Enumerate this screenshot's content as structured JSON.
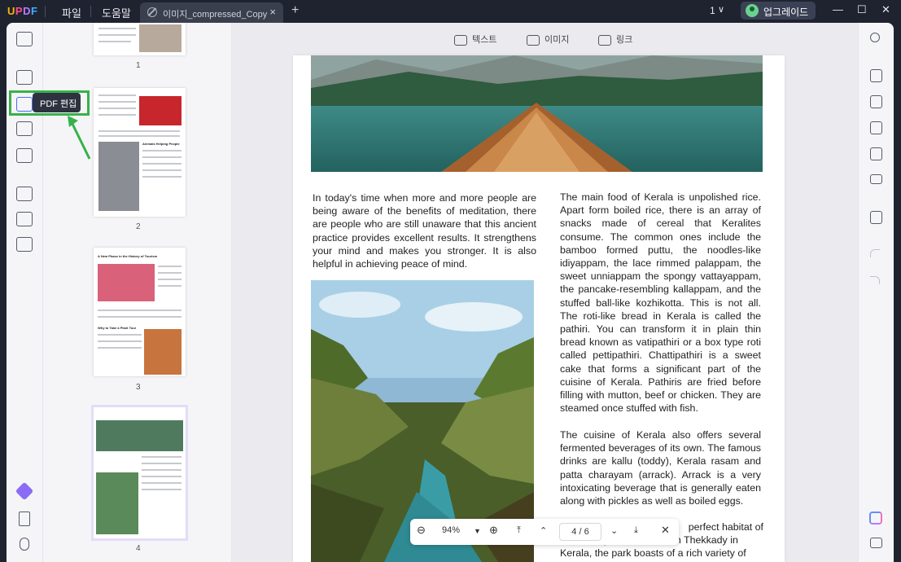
{
  "app": {
    "name_parts": [
      "U",
      "P",
      "D",
      "F"
    ]
  },
  "menu": {
    "file": "파일",
    "help": "도움말"
  },
  "tab": {
    "title": "이미지_compressed_Copy",
    "close": "×",
    "add": "+"
  },
  "titlebar": {
    "page_indicator": "1",
    "chevron": "∨",
    "upgrade_label": "업그레이드",
    "minimize": "—",
    "maximize": "☐",
    "close": "✕"
  },
  "tooltip": {
    "label": "PDF 편집"
  },
  "toolbar": {
    "text_label": "텍스트",
    "image_label": "이미지",
    "link_label": "링크"
  },
  "thumbnails": [
    {
      "number": "1"
    },
    {
      "number": "2",
      "heading": "Animals Helping People"
    },
    {
      "number": "3",
      "heading": "A New Phase in the History of Tourism",
      "subheading": "Why to Take a Plant Tour"
    },
    {
      "number": "4"
    }
  ],
  "document": {
    "left_paragraph": "In today's time when more and more people are being aware of the benefits of meditation, there are people who are still unaware that this ancient practice provides excellent results. It strengthens your mind and makes you stronger. It is also helpful in achieving peace of mind.",
    "right_paragraph_1": "The main food of Kerala is unpolished rice. Apart form boiled rice, there is an array of snacks made of cereal that Keralites consume. The common ones include the bamboo formed puttu, the noodles-like idiyappam, the lace rimmed palappam, the sweet unniappam the spongy vattayappam, the pancake-resembling kallappam, and the stuffed ball-like kozhikotta. This is not all. The roti-like bread in Kerala is called the pathiri. You can transform it in plain thin bread known as vatipathiri or a box type roti called pettipathiri. Chattipathiri is a sweet cake that forms a significant part of the cuisine of Kerala. Pathiris are fried before filling with mutton, beef or chicken. They are steamed once stuffed with fish.",
    "right_paragraph_2": "The cuisine of Kerala also offers several fermented beverages of its own. The famous drinks are kallu (toddy), Kerala rasam and patta charayam (arrack). Arrack is a very intoxicating beverage that is generally eaten along with pickles as well as boiled eggs.",
    "right_paragraph_3_visible": "perfect habitat of",
    "right_line_2": "Indian elephant. Located in Thekkady in",
    "right_line_3": "Kerala, the park boasts of a rich variety of"
  },
  "zoombar": {
    "zoom": "94%",
    "page": "4",
    "slash": "/",
    "total": "6"
  },
  "colors": {
    "accent": "#4a6cf7",
    "highlight": "#36b24a",
    "titlebar": "#1f2330"
  }
}
